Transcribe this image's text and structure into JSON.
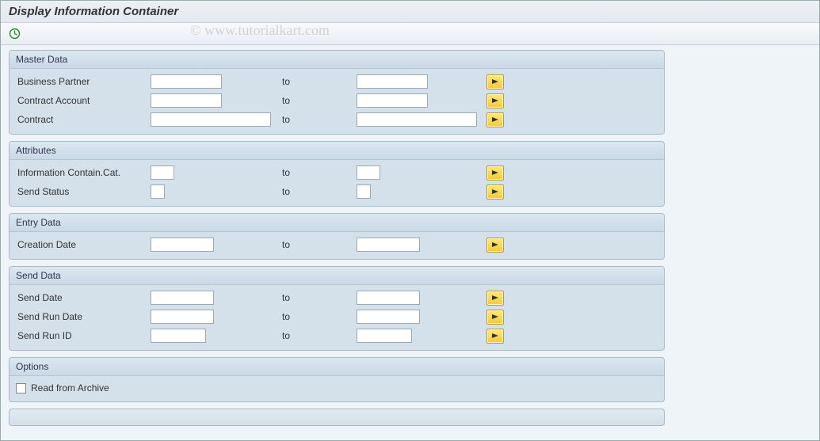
{
  "window": {
    "title": "Display Information Container"
  },
  "toolbar": {
    "execute_icon": "execute-icon"
  },
  "watermark": "© www.tutorialkart.com",
  "to_label": "to",
  "groups": {
    "master": {
      "title": "Master Data",
      "rows": {
        "bp": {
          "label": "Business Partner",
          "from": "",
          "to": ""
        },
        "ca": {
          "label": "Contract Account",
          "from": "",
          "to": ""
        },
        "co": {
          "label": "Contract",
          "from": "",
          "to": ""
        }
      }
    },
    "attributes": {
      "title": "Attributes",
      "rows": {
        "cat": {
          "label": "Information Contain.Cat.",
          "from": "",
          "to": ""
        },
        "status": {
          "label": "Send Status",
          "from": "",
          "to": ""
        }
      }
    },
    "entry": {
      "title": "Entry Data",
      "rows": {
        "cdate": {
          "label": "Creation Date",
          "from": "",
          "to": ""
        }
      }
    },
    "send": {
      "title": "Send Data",
      "rows": {
        "sdate": {
          "label": "Send Date",
          "from": "",
          "to": ""
        },
        "srdate": {
          "label": "Send Run Date",
          "from": "",
          "to": ""
        },
        "srid": {
          "label": "Send Run ID",
          "from": "",
          "to": ""
        }
      }
    },
    "options": {
      "title": "Options",
      "checkbox": {
        "label": "Read from Archive",
        "checked": false
      }
    }
  }
}
